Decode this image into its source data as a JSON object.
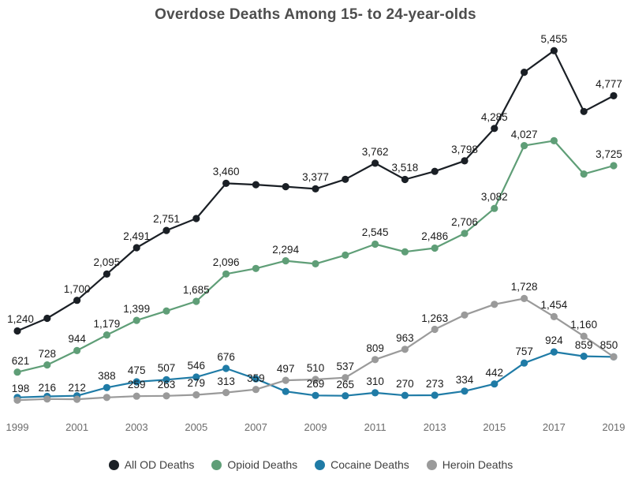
{
  "title": "Overdose Deaths Among 15- to 24-year-olds",
  "legend": {
    "items": [
      {
        "label": "All OD Deaths",
        "color": "#1a1f25",
        "key": "all_od"
      },
      {
        "label": "Opioid Deaths",
        "color": "#5f9e77",
        "key": "opioid"
      },
      {
        "label": "Cocaine Deaths",
        "color": "#1f7ba6",
        "key": "cocaine"
      },
      {
        "label": "Heroin Deaths",
        "color": "#9a9a9a",
        "key": "heroin"
      }
    ]
  },
  "axis": {
    "x_tick_labels": [
      "1999",
      "2001",
      "2003",
      "2005",
      "2007",
      "2009",
      "2011",
      "2013",
      "2015",
      "2017",
      "2019"
    ]
  },
  "chart_data": {
    "type": "line",
    "title": "Overdose Deaths Among 15- to 24-year-olds",
    "xlabel": "",
    "ylabel": "",
    "grid": false,
    "legend_position": "bottom",
    "x": [
      1999,
      2000,
      2001,
      2002,
      2003,
      2004,
      2005,
      2006,
      2007,
      2008,
      2009,
      2010,
      2011,
      2012,
      2013,
      2014,
      2015,
      2016,
      2017,
      2018,
      2019
    ],
    "xlim": [
      1999,
      2019
    ],
    "ylim": [
      0,
      5600
    ],
    "series": [
      {
        "name": "All OD Deaths",
        "color": "#1a1f25",
        "values": [
          1240,
          1430,
          1700,
          2095,
          2491,
          2751,
          2930,
          3460,
          3440,
          3410,
          3377,
          3520,
          3762,
          3518,
          3640,
          3798,
          4285,
          5130,
          5455,
          4540,
          4777
        ],
        "labels": [
          "1,240",
          null,
          "1,700",
          "2,095",
          "2,491",
          "2,751",
          null,
          "3,460",
          null,
          null,
          "3,377",
          null,
          "3,762",
          "3,518",
          null,
          "3,798",
          "4,285",
          null,
          "5,455",
          null,
          "4,777"
        ]
      },
      {
        "name": "Opioid Deaths",
        "color": "#5f9e77",
        "values": [
          621,
          728,
          944,
          1179,
          1399,
          1540,
          1685,
          2096,
          2180,
          2294,
          2250,
          2380,
          2545,
          2430,
          2486,
          2706,
          3082,
          4027,
          4100,
          3600,
          3725
        ],
        "labels": [
          "621",
          "728",
          "944",
          "1,179",
          "1,399",
          null,
          "1,685",
          "2,096",
          null,
          "2,294",
          null,
          null,
          "2,545",
          null,
          "2,486",
          "2,706",
          "3,082",
          "4,027",
          null,
          null,
          "3,725"
        ]
      },
      {
        "name": "Cocaine Deaths",
        "color": "#1f7ba6",
        "values": [
          240,
          255,
          265,
          388,
          475,
          507,
          546,
          676,
          520,
          330,
          269,
          265,
          310,
          270,
          273,
          334,
          442,
          757,
          924,
          859,
          850
        ],
        "labels": [
          null,
          null,
          null,
          "388",
          "475",
          "507",
          "546",
          "676",
          null,
          null,
          "269",
          "265",
          "310",
          "270",
          "273",
          "334",
          "442",
          "757",
          "924",
          "859",
          null
        ]
      },
      {
        "name": "Heroin Deaths",
        "color": "#9a9a9a",
        "values": [
          198,
          216,
          212,
          240,
          259,
          263,
          279,
          313,
          359,
          497,
          510,
          537,
          809,
          963,
          1263,
          1480,
          1640,
          1728,
          1454,
          1160,
          850
        ],
        "labels": [
          "198",
          "216",
          "212",
          null,
          "259",
          "263",
          "279",
          "313",
          "359",
          "497",
          "510",
          "537",
          "809",
          "963",
          "1,263",
          null,
          null,
          "1,728",
          "1,454",
          "1,160",
          "850"
        ]
      }
    ]
  }
}
